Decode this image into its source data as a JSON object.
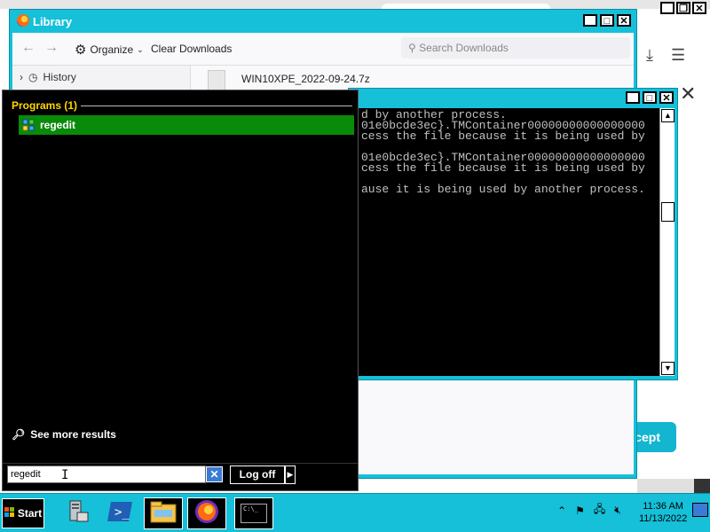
{
  "library": {
    "title": "Library",
    "organize_label": "Organize",
    "clear_downloads_label": "Clear Downloads",
    "search_placeholder": "Search Downloads",
    "sidebar_history_label": "History",
    "download_item_name": "WIN10XPE_2022-09-24.7z"
  },
  "browser": {
    "accept_label": "ccept"
  },
  "console": {
    "lines": [
      "d by another process.",
      "01e0bcde3ec}.TMContainer00000000000000000",
      "cess the file because it is being used by",
      "",
      "01e0bcde3ec}.TMContainer00000000000000000",
      "cess the file because it is being used by",
      "",
      "ause it is being used by another process."
    ]
  },
  "startmenu": {
    "programs_header": "Programs (1)",
    "result_label": "regedit",
    "see_more_label": "See more results",
    "search_value": "regedit",
    "logoff_label": "Log off"
  },
  "taskbar": {
    "start_label": "Start",
    "cmd_label": "C:\\_",
    "time": "11:36 AM",
    "date": "11/13/2022"
  },
  "colors": {
    "accent_cyan": "#15c0d8",
    "highlight_green": "#0a8a0a",
    "programs_header_gold": "#ffd700"
  }
}
